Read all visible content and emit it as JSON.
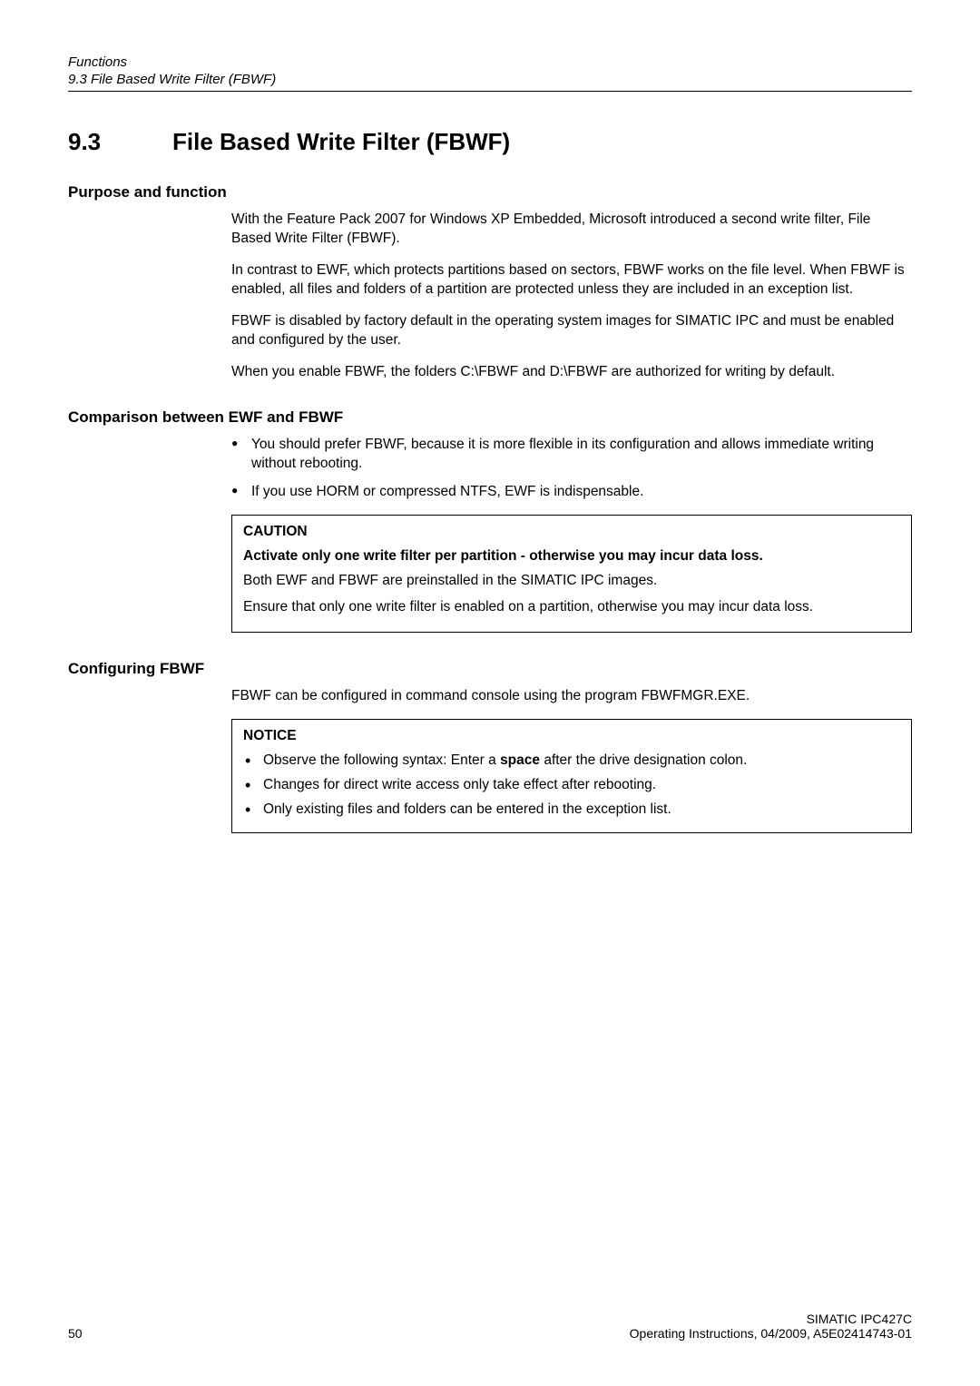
{
  "runningHeader": {
    "title": "Functions",
    "section": "9.3 File Based Write Filter (FBWF)"
  },
  "heading": {
    "number": "9.3",
    "title": "File Based Write Filter (FBWF)"
  },
  "purpose": {
    "heading": "Purpose and function",
    "p1": "With the Feature Pack 2007 for Windows XP Embedded, Microsoft introduced a second write filter, File Based Write Filter (FBWF).",
    "p2": "In contrast to EWF, which protects partitions based on sectors, FBWF works on the file level. When FBWF is enabled, all files and folders of a partition are protected unless they are included in an exception list.",
    "p3": "FBWF is disabled by factory default in the operating system images for SIMATIC IPC and must be enabled and configured by the user.",
    "p4": "When you enable FBWF, the folders C:\\FBWF and D:\\FBWF are authorized for writing by default."
  },
  "comparison": {
    "heading": "Comparison between EWF and FBWF",
    "bullets": [
      "You should prefer FBWF, because it is more flexible in its configuration and allows immediate writing without rebooting.",
      "If you use HORM or compressed NTFS, EWF is indispensable."
    ],
    "caution": {
      "label": "CAUTION",
      "title": "Activate only one write filter per partition - otherwise you may incur data loss.",
      "p1": "Both EWF and FBWF are preinstalled in the SIMATIC IPC images.",
      "p2": "Ensure that only one write filter is enabled on a partition, otherwise you may incur data loss."
    }
  },
  "configuring": {
    "heading": "Configuring FBWF",
    "p1": "FBWF can be configured in command console using the program FBWFMGR.EXE.",
    "notice": {
      "label": "NOTICE",
      "bullet1_pre": "Observe the following syntax: Enter a ",
      "bullet1_bold": "space",
      "bullet1_post": " after the drive designation colon.",
      "bullet2": "Changes for direct write access only take effect after rebooting.",
      "bullet3": "Only existing files and folders can be entered in the exception list."
    }
  },
  "footer": {
    "pageNumber": "50",
    "product": "SIMATIC IPC427C",
    "docinfo": "Operating Instructions, 04/2009, A5E02414743-01"
  }
}
